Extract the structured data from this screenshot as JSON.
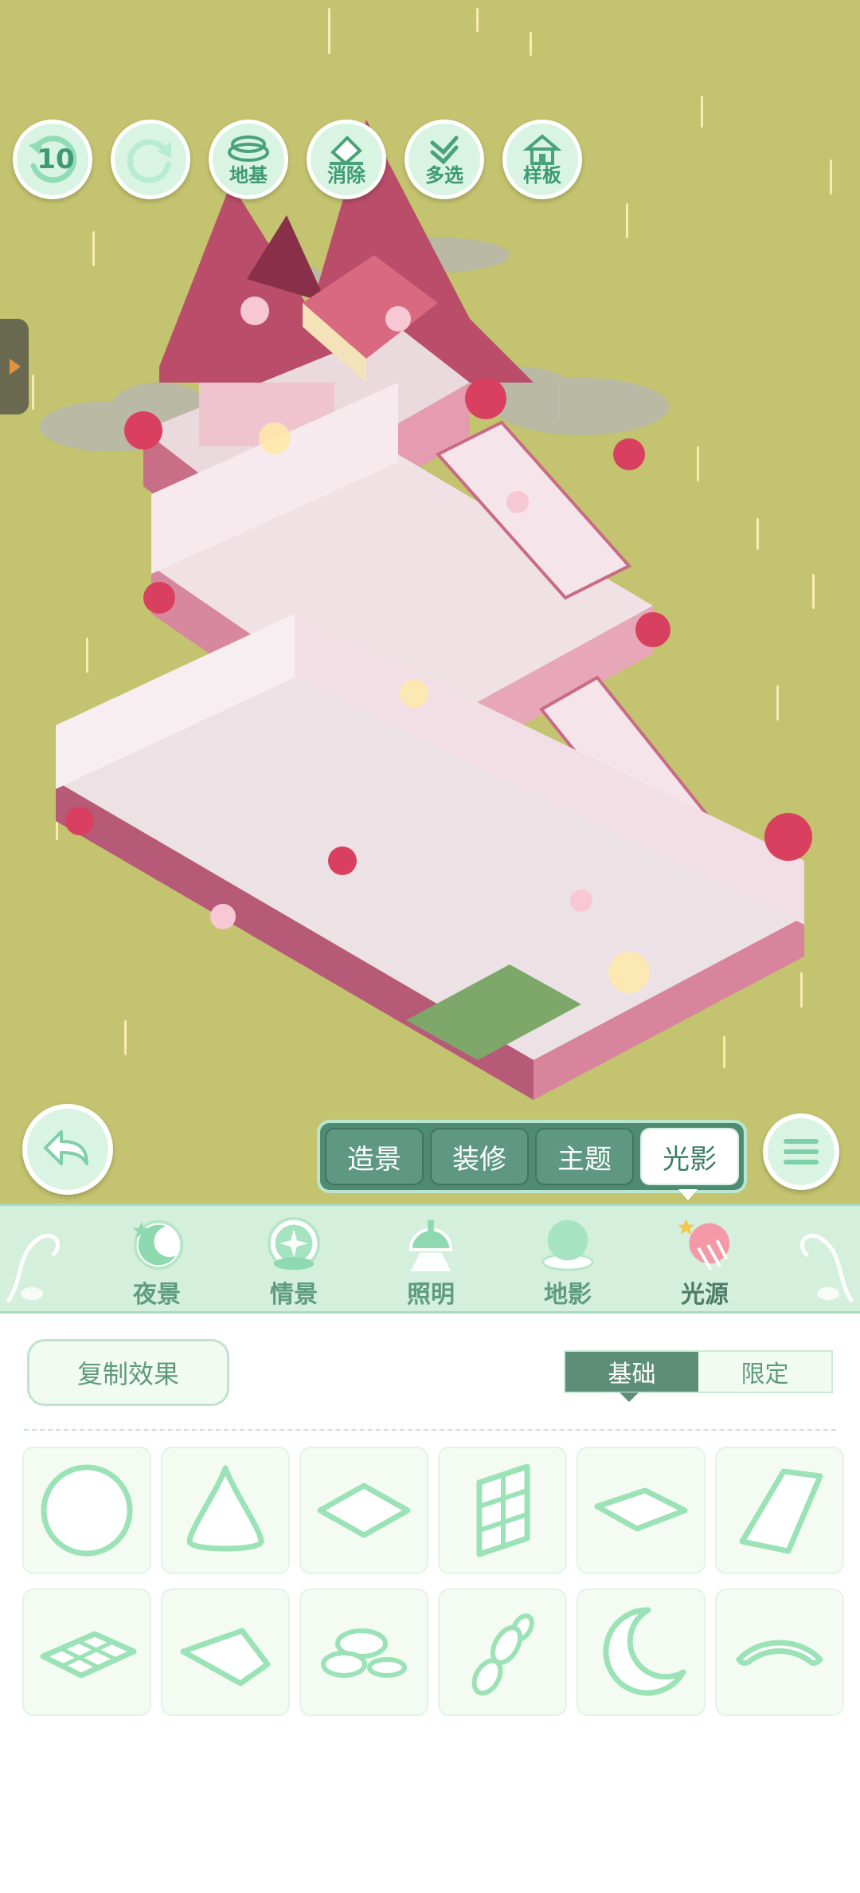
{
  "toolbar": {
    "undo_count": "10",
    "foundation_label": "地基",
    "erase_label": "消除",
    "multiselect_label": "多选",
    "template_label": "样板"
  },
  "mode_tabs": [
    {
      "label": "造景",
      "active": false
    },
    {
      "label": "装修",
      "active": false
    },
    {
      "label": "主题",
      "active": false
    },
    {
      "label": "光影",
      "active": true
    }
  ],
  "categories": [
    {
      "label": "夜景",
      "icon": "moon-night-icon"
    },
    {
      "label": "情景",
      "icon": "sparkle-scene-icon"
    },
    {
      "label": "照明",
      "icon": "lamp-icon"
    },
    {
      "label": "地影",
      "icon": "ground-shadow-icon"
    },
    {
      "label": "光源",
      "icon": "light-source-icon",
      "active": true
    }
  ],
  "actions": {
    "copy_effect_label": "复制效果"
  },
  "filter": {
    "basic_label": "基础",
    "limited_label": "限定",
    "selected": "基础"
  },
  "light_shapes": [
    "circle-light-icon",
    "cone-light-icon",
    "diamond-light-icon",
    "window-light-icon",
    "flat-diamond-light-icon",
    "trapezoid-light-icon",
    "grid-tile-light-icon",
    "kite-light-icon",
    "cloud-spots-light-icon",
    "bubbles-light-icon",
    "crescent-light-icon",
    "arc-light-icon"
  ],
  "colors": {
    "scene_bg": "#c3c370",
    "accent_green": "#4f8a73",
    "icon_stroke": "#9be3b6",
    "panel_bg": "#d4efdc"
  }
}
